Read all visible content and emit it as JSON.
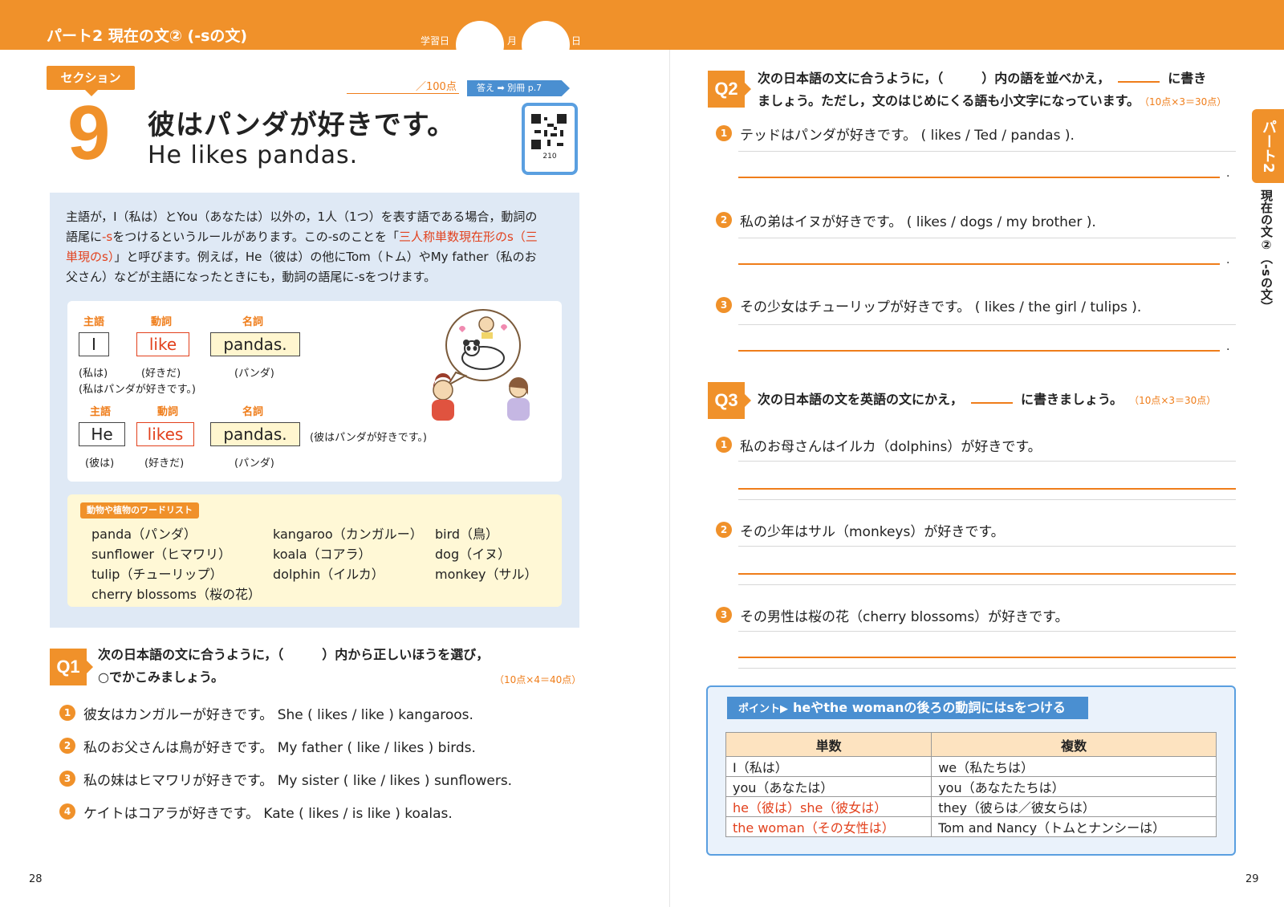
{
  "header": {
    "part_title": "パート2 現在の文② (-sの文)",
    "study_day": "学習日",
    "month": "月",
    "day": "日"
  },
  "section": {
    "badge": "セクション",
    "number": "9",
    "title_jp": "彼はパンダが好きです。",
    "title_en": "He likes pandas.",
    "score": "／100点",
    "answer_tag": "答え ➡ 別冊 p.7",
    "qr_number": "210"
  },
  "explanation": {
    "line1": "主語が，I（私は）とYou（あなたは）以外の，1人（1つ）を表す語である場合，動詞の",
    "line2a": "語尾に",
    "line2b": "-s",
    "line2c": "をつけるというルールがあります。この-sのことを「",
    "line2d": "三人称単数現在形のs（三",
    "line3a": "単現のs）",
    "line3b": "」と呼びます。例えば，He（彼は）の他にTom（トム）やMy father（私のお",
    "line4": "父さん）などが主語になったときにも，動詞の語尾に-sをつけます。"
  },
  "example": {
    "h_subject": "主語",
    "h_verb": "動詞",
    "h_noun": "名詞",
    "s1_subject": "I",
    "s1_verb": "like",
    "s1_noun": "pandas.",
    "s1_g_subject": "(私は)",
    "s1_g_verb": "(好きだ)",
    "s1_g_noun": "(パンダ)",
    "s1_translation": "(私はパンダが好きです。)",
    "s2_subject": "He",
    "s2_verb": "likes",
    "s2_noun": "pandas.",
    "s2_g_subject": "(彼は)",
    "s2_g_verb": "(好きだ)",
    "s2_g_noun": "(パンダ)",
    "s2_translation": "(彼はパンダが好きです。)"
  },
  "wordlist": {
    "title": "動物や植物のワードリスト",
    "col1": [
      "panda（パンダ）",
      "sunflower（ヒマワリ）",
      "tulip（チューリップ）",
      "cherry blossoms（桜の花）"
    ],
    "col2": [
      "kangaroo（カンガルー）",
      "koala（コアラ）",
      "dolphin（イルカ）"
    ],
    "col3": [
      "bird（鳥）",
      "dog（イヌ）",
      "monkey（サル）"
    ]
  },
  "q1": {
    "badge": "Q1",
    "inst1": "次の日本語の文に合うように，（　　　）内から正しいほうを選び，",
    "inst2": "○でかこみましょう。",
    "points": "（10点×4＝40点）",
    "items": [
      {
        "n": "1",
        "text": "彼女はカンガルーが好きです。 She ( likes / like ) kangaroos."
      },
      {
        "n": "2",
        "text": "私のお父さんは鳥が好きです。 My father ( like / likes ) birds."
      },
      {
        "n": "3",
        "text": "私の妹はヒマワリが好きです。 My sister ( like / likes ) sunflowers."
      },
      {
        "n": "4",
        "text": "ケイトはコアラが好きです。 Kate ( likes / is like ) koalas."
      }
    ]
  },
  "q2": {
    "badge": "Q2",
    "inst1a": "次の日本語の文に合うように，（　　　）内の語を並べかえ，",
    "inst1b": "に書き",
    "inst2": "ましょう。ただし，文のはじめにくる語も小文字になっています。",
    "points": "（10点×3＝30点）",
    "items": [
      {
        "n": "1",
        "text": "テッドはパンダが好きです。 ( likes / Ted / pandas )."
      },
      {
        "n": "2",
        "text": "私の弟はイヌが好きです。 ( likes / dogs / my brother )."
      },
      {
        "n": "3",
        "text": "その少女はチューリップが好きです。 ( likes / the girl / tulips )."
      }
    ],
    "period": "."
  },
  "q3": {
    "badge": "Q3",
    "inst_a": "次の日本語の文を英語の文にかえ，",
    "inst_b": "に書きましょう。",
    "points": "（10点×3＝30点）",
    "items": [
      {
        "n": "1",
        "text": "私のお母さんはイルカ（dolphins）が好きです。"
      },
      {
        "n": "2",
        "text": "その少年はサル（monkeys）が好きです。"
      },
      {
        "n": "3",
        "text": "その男性は桜の花（cherry blossoms）が好きです。"
      }
    ]
  },
  "side_tab": {
    "label": "パート2",
    "text": "現在の文②（-sの文）"
  },
  "point": {
    "label": "ポイント▶",
    "title": "heやthe womanの後ろの動詞にはsをつける",
    "headers": [
      "単数",
      "複数"
    ],
    "rows": [
      [
        "I（私は）",
        "we（私たちは）"
      ],
      [
        "you（あなたは）",
        "you（あなたたちは）"
      ],
      [
        "he（彼は）she（彼女は）",
        "they（彼らは／彼女らは）"
      ],
      [
        "the woman（その女性は）",
        "Tom and Nancy（トムとナンシーは）"
      ]
    ]
  },
  "page_numbers": {
    "left": "28",
    "right": "29"
  },
  "colors": {
    "accent": "#f0912a",
    "red": "#e2401c",
    "blue": "#4a8fd1",
    "box_bg": "#dfe9f5"
  }
}
